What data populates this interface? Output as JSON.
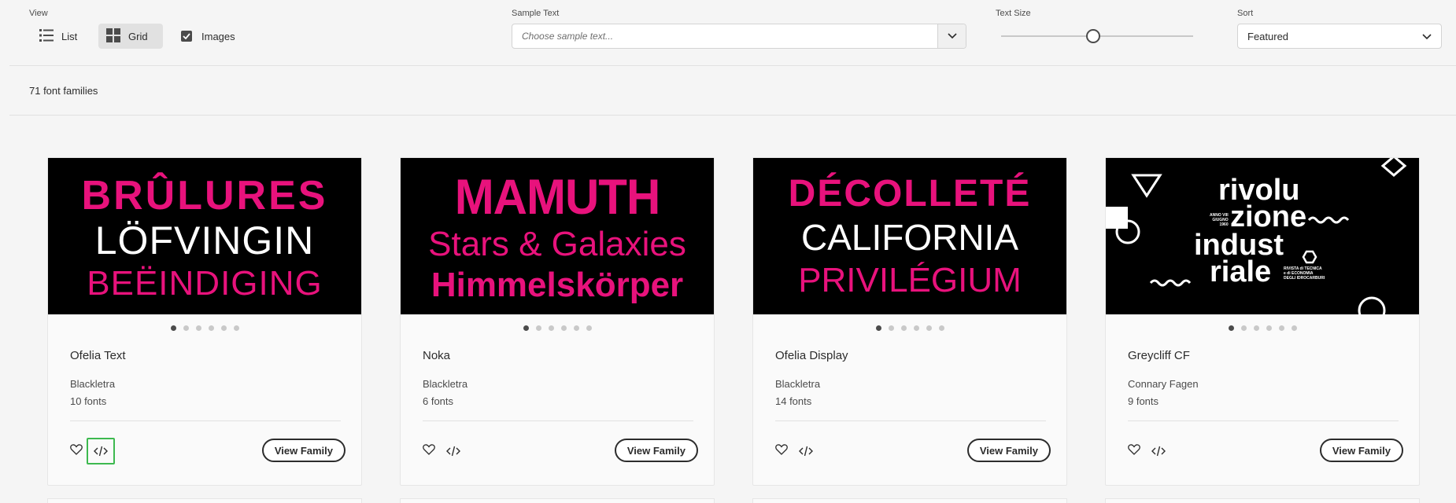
{
  "toolbar": {
    "view_label": "View",
    "list_label": "List",
    "grid_label": "Grid",
    "images_label": "Images",
    "images_checked": true,
    "sample_text_label": "Sample Text",
    "sample_text_placeholder": "Choose sample text...",
    "text_size_label": "Text Size",
    "text_size_fraction": 0.48,
    "sort_label": "Sort",
    "sort_value": "Featured"
  },
  "results": {
    "count_text": "71 font families"
  },
  "colors": {
    "accent_pink": "#e8127c",
    "background": "#f5f5f5",
    "focus_green": "#3db94f"
  },
  "cards": [
    {
      "preview_lines": [
        "BRÛLURES",
        "LÖFVINGIN",
        "BEËINDIGING"
      ],
      "name": "Ofelia Text",
      "foundry": "Blackletra",
      "fonts": "10 fonts",
      "view_label": "View Family",
      "active_dot": 0
    },
    {
      "preview_lines": [
        "MAMUTH",
        "Stars & Galaxies",
        "Himmelskörper"
      ],
      "name": "Noka",
      "foundry": "Blackletra",
      "fonts": "6 fonts",
      "view_label": "View Family",
      "active_dot": 0
    },
    {
      "preview_lines": [
        "DÉCOLLETÉ",
        "CALIFORNIA",
        "PRIVILÉGIUM"
      ],
      "name": "Ofelia Display",
      "foundry": "Blackletra",
      "fonts": "14 fonts",
      "view_label": "View Family",
      "active_dot": 0
    },
    {
      "preview_lines": [
        "rivolu",
        "zione",
        "indust",
        "riale"
      ],
      "preview_small": [
        "ANNO VIII",
        "GIUGNO",
        "1960",
        "RIVISTA di TECNICA",
        "e di ECONOMIA",
        "DEGLI IDROCARBURI"
      ],
      "name": "Greycliff CF",
      "foundry": "Connary Fagen",
      "fonts": "9 fonts",
      "view_label": "View Family",
      "active_dot": 0
    }
  ]
}
